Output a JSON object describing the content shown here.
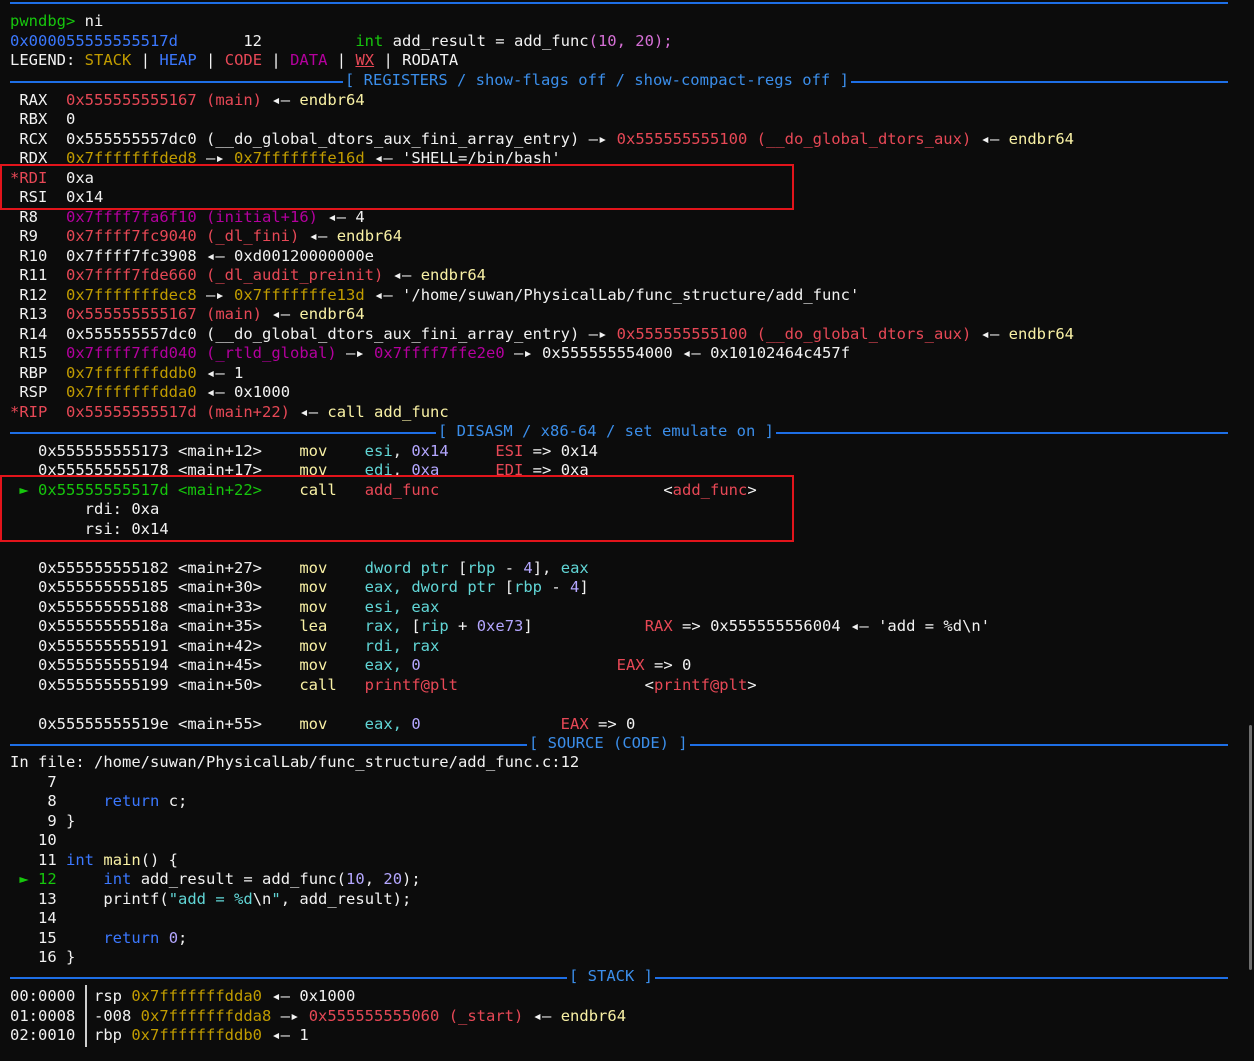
{
  "prompt": "pwndbg>",
  "command": "ni",
  "current": {
    "addr": "0x000055555555517d",
    "line": "12",
    "type_kw": "int",
    "code_pre": "add_result = ",
    "fn": "add_func",
    "args": "(10, 20);"
  },
  "legend": {
    "label": "LEGEND:",
    "stack": "STACK",
    "heap": "HEAP",
    "code": "CODE",
    "data": "DATA",
    "wx": "WX",
    "rodata": "RODATA",
    "bar": "|"
  },
  "sections": {
    "registers": "[ REGISTERS / show-flags off / show-compact-regs off ]",
    "disasm": "[ DISASM / x86-64 / set emulate on ]",
    "source": "[ SOURCE (CODE) ]",
    "stack": "[ STACK ]"
  },
  "registers": {
    "rax": {
      "name": "RAX",
      "val": "0x555555555167",
      "sym": "(main)",
      "arrow": "◂—",
      "tail": "endbr64"
    },
    "rbx": {
      "name": "RBX",
      "val": "0"
    },
    "rcx": {
      "name": "RCX",
      "val": "0x555555557dc0",
      "sym": "(__do_global_dtors_aux_fini_array_entry)",
      "arrow": "—▸",
      "val2": "0x555555555100",
      "sym2": "(__do_global_dtors_aux)",
      "arrow2": "◂—",
      "tail": "endbr64"
    },
    "rdx": {
      "name": "RDX",
      "val": "0x7fffffffded8",
      "arrow": "—▸",
      "val2": "0x7fffffffe16d",
      "arrow2": "◂—",
      "tail": "'SHELL=/bin/bash'"
    },
    "rdi": {
      "star": "*",
      "name": "RDI",
      "val": "0xa"
    },
    "rsi": {
      "name": "RSI",
      "val": "0x14"
    },
    "r8": {
      "name": "R8",
      "val": "0x7ffff7fa6f10",
      "sym": "(initial+16)",
      "arrow": "◂—",
      "tail": "4"
    },
    "r9": {
      "name": "R9",
      "val": "0x7ffff7fc9040",
      "sym": "(_dl_fini)",
      "arrow": "◂—",
      "tail": "endbr64"
    },
    "r10": {
      "name": "R10",
      "val": "0x7ffff7fc3908",
      "arrow": "◂—",
      "tail": "0xd00120000000e"
    },
    "r11": {
      "name": "R11",
      "val": "0x7ffff7fde660",
      "sym": "(_dl_audit_preinit)",
      "arrow": "◂—",
      "tail": "endbr64"
    },
    "r12": {
      "name": "R12",
      "val": "0x7fffffffdec8",
      "arrow": "—▸",
      "val2": "0x7fffffffe13d",
      "arrow2": "◂—",
      "tail": "'/home/suwan/PhysicalLab/func_structure/add_func'"
    },
    "r13": {
      "name": "R13",
      "val": "0x555555555167",
      "sym": "(main)",
      "arrow": "◂—",
      "tail": "endbr64"
    },
    "r14": {
      "name": "R14",
      "val": "0x555555557dc0",
      "sym": "(__do_global_dtors_aux_fini_array_entry)",
      "arrow": "—▸",
      "val2": "0x555555555100",
      "sym2": "(__do_global_dtors_aux)",
      "arrow2": "◂—",
      "tail": "endbr64"
    },
    "r15": {
      "name": "R15",
      "val": "0x7ffff7ffd040",
      "sym": "(_rtld_global)",
      "arrow": "—▸",
      "val2": "0x7ffff7ffe2e0",
      "arrow2": "—▸",
      "val3": "0x555555554000",
      "arrow3": "◂—",
      "tail": "0x10102464c457f"
    },
    "rbp": {
      "name": "RBP",
      "val": "0x7fffffffddb0",
      "arrow": "◂—",
      "tail": "1"
    },
    "rsp": {
      "name": "RSP",
      "val": "0x7fffffffdda0",
      "arrow": "◂—",
      "tail": "0x1000"
    },
    "rip": {
      "star": "*",
      "name": "RIP",
      "val": "0x55555555517d",
      "sym": "(main+22)",
      "arrow": "◂—",
      "ins": "call",
      "target": "add_func"
    }
  },
  "disasm": {
    "l1": {
      "addr": "0x555555555173",
      "off": "<main+12>",
      "mn": "mov",
      "a": "esi",
      "b": "0x14",
      "cmt_reg": "ESI",
      "cmt_arrow": "=>",
      "cmt_val": "0x14"
    },
    "l2": {
      "addr": "0x555555555178",
      "off": "<main+17>",
      "mn": "mov",
      "a": "edi",
      "b": "0xa",
      "cmt_reg": "EDI",
      "cmt_arrow": "=>",
      "cmt_val": "0xa"
    },
    "l3": {
      "marker": "►",
      "addr": "0x55555555517d",
      "off": "<main+22>",
      "mn": "call",
      "target": "add_func",
      "lt": "<",
      "tsym": "add_func",
      "gt": ">"
    },
    "arg1": {
      "name": "rdi:",
      "val": "0xa"
    },
    "arg2": {
      "name": "rsi:",
      "val": "0x14"
    },
    "l4": {
      "addr": "0x555555555182",
      "off": "<main+27>",
      "mn": "mov",
      "a": "dword ptr",
      "lb": "[",
      "reg": "rbp",
      "op": "-",
      "num": "4",
      "rb": "],",
      "b": "eax"
    },
    "l5": {
      "addr": "0x555555555185",
      "off": "<main+30>",
      "mn": "mov",
      "a": "eax,",
      "b": "dword ptr",
      "lb": "[",
      "reg": "rbp",
      "op": "-",
      "num": "4",
      "rb": "]"
    },
    "l6": {
      "addr": "0x555555555188",
      "off": "<main+33>",
      "mn": "mov",
      "a": "esi,",
      "b": "eax"
    },
    "l7": {
      "addr": "0x55555555518a",
      "off": "<main+35>",
      "mn": "lea",
      "a": "rax,",
      "lb": "[",
      "reg": "rip",
      "op": "+",
      "num": "0xe73",
      "rb": "]",
      "cmt_reg": "RAX",
      "cmt_arrow": "=>",
      "cmt_val": "0x555555556004",
      "cmt_arrow2": "◂—",
      "cmt_str": "'add = %d\\n'"
    },
    "l8": {
      "addr": "0x555555555191",
      "off": "<main+42>",
      "mn": "mov",
      "a": "rdi,",
      "b": "rax"
    },
    "l9": {
      "addr": "0x555555555194",
      "off": "<main+45>",
      "mn": "mov",
      "a": "eax,",
      "b": "0",
      "cmt_reg": "EAX",
      "cmt_arrow": "=>",
      "cmt_val": "0"
    },
    "l10": {
      "addr": "0x555555555199",
      "off": "<main+50>",
      "mn": "call",
      "target": "printf@plt",
      "lt": "<",
      "tsym": "printf@plt",
      "gt": ">"
    },
    "l11": {
      "addr": "0x55555555519e",
      "off": "<main+55>",
      "mn": "mov",
      "a": "eax,",
      "b": "0",
      "cmt_reg": "EAX",
      "cmt_arrow": "=>",
      "cmt_val": "0"
    }
  },
  "source": {
    "file_label": "In file:",
    "file_path": "/home/suwan/PhysicalLab/func_structure/add_func.c:12",
    "l7": {
      "no": "7"
    },
    "l8": {
      "no": "8",
      "kw": "return",
      "rest": "c;"
    },
    "l9": {
      "no": "9",
      "rest": "}"
    },
    "l10": {
      "no": "10"
    },
    "l11": {
      "no": "11",
      "kw": "int",
      "fn": "main",
      "rest": "() {"
    },
    "l12": {
      "marker": "►",
      "no": "12",
      "kw": "int",
      "mid": "add_result = add_func(",
      "n1": "10",
      "comma": ", ",
      "n2": "20",
      "end": ");"
    },
    "l13": {
      "no": "13",
      "fn": "printf",
      "open": "(",
      "str": "\"add = %d",
      "esc": "\\n",
      "strend": "\"",
      "rest": ", add_result);"
    },
    "l14": {
      "no": "14"
    },
    "l15": {
      "no": "15",
      "kw": "return",
      "num": "0",
      "rest": ";"
    },
    "l16": {
      "no": "16",
      "rest": "}"
    }
  },
  "stack": {
    "s0": {
      "idx": "00:0000",
      "reg": "rsp",
      "addr": "0x7fffffffdda0",
      "arrow": "◂—",
      "val": "0x1000"
    },
    "s1": {
      "idx": "01:0008",
      "reg": "-008",
      "addr": "0x7fffffffdda8",
      "arrow": "—▸",
      "val": "0x555555555060",
      "sym": "(_start)",
      "arrow2": "◂—",
      "tail": "endbr64"
    },
    "s2": {
      "idx": "02:0010",
      "reg": "rbp",
      "addr": "0x7fffffffddb0",
      "arrow": "◂—",
      "val": "1"
    }
  }
}
